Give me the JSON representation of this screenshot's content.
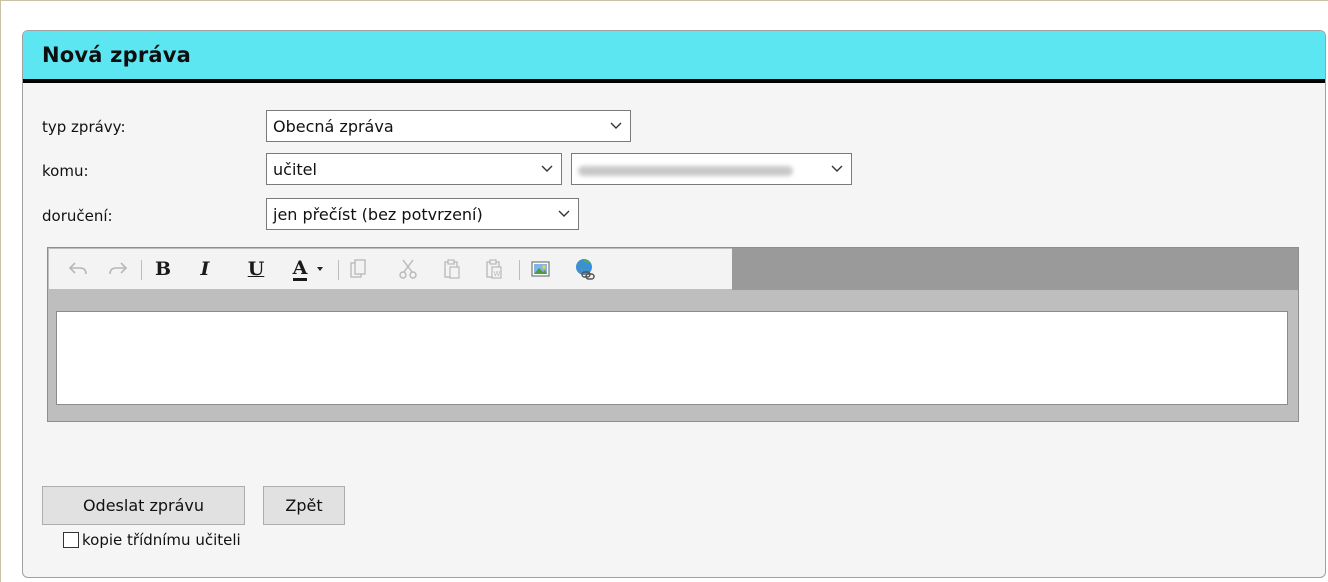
{
  "panel": {
    "title": "Nová zpráva"
  },
  "form": {
    "type_label": "typ zprávy:",
    "type_value": "Obecná zpráva",
    "to_label": "komu:",
    "to_value": "učitel",
    "recipient_value": "",
    "delivery_label": "doručení:",
    "delivery_value": "jen přečíst (bez potvrzení)"
  },
  "toolbar": {
    "items": [
      {
        "name": "undo-icon",
        "enabled": false
      },
      {
        "name": "redo-icon",
        "enabled": false
      },
      {
        "name": "bold-button",
        "label": "B"
      },
      {
        "name": "italic-button",
        "label": "I"
      },
      {
        "name": "underline-button",
        "label": "U"
      },
      {
        "name": "font-color-button",
        "label": "A"
      },
      {
        "name": "copy-icon",
        "enabled": false
      },
      {
        "name": "cut-icon",
        "enabled": false
      },
      {
        "name": "paste-icon",
        "enabled": false
      },
      {
        "name": "paste-word-icon",
        "enabled": false
      },
      {
        "name": "insert-image-icon",
        "enabled": true
      },
      {
        "name": "insert-link-icon",
        "enabled": true
      }
    ],
    "bold_label": "B",
    "italic_label": "I",
    "underline_label": "U",
    "color_label": "A",
    "color_accent": "#1a1a1a"
  },
  "actions": {
    "send_label": "Odeslat zprávu",
    "back_label": "Zpět",
    "copy_checkbox_label": "kopie třídnímu učiteli",
    "copy_checkbox_checked": false
  },
  "colors": {
    "header_bg": "#5ce6f1",
    "header_border": "#000000",
    "panel_bg": "#f5f5f5"
  }
}
